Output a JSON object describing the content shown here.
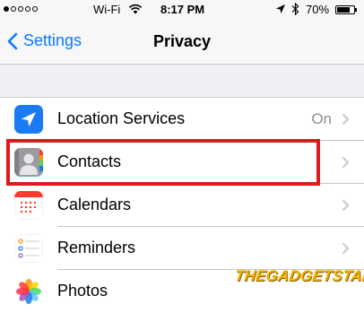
{
  "status_bar": {
    "signal": "●○○○○",
    "carrier": "Wi-Fi",
    "time": "8:17 PM",
    "battery": "70%"
  },
  "nav": {
    "back_label": "Settings",
    "title": "Privacy"
  },
  "rows": [
    {
      "label": "Location Services",
      "value": "On",
      "icon": "location-arrow-icon"
    },
    {
      "label": "Contacts",
      "value": "",
      "icon": "contacts-icon"
    },
    {
      "label": "Calendars",
      "value": "",
      "icon": "calendar-icon"
    },
    {
      "label": "Reminders",
      "value": "",
      "icon": "reminders-icon"
    },
    {
      "label": "Photos",
      "value": "",
      "icon": "photos-icon"
    }
  ],
  "watermark": "THEGADGETSTALK",
  "colors": {
    "accent": "#0a7aff",
    "highlight": "#e0191f",
    "watermark": "#f6b300"
  }
}
